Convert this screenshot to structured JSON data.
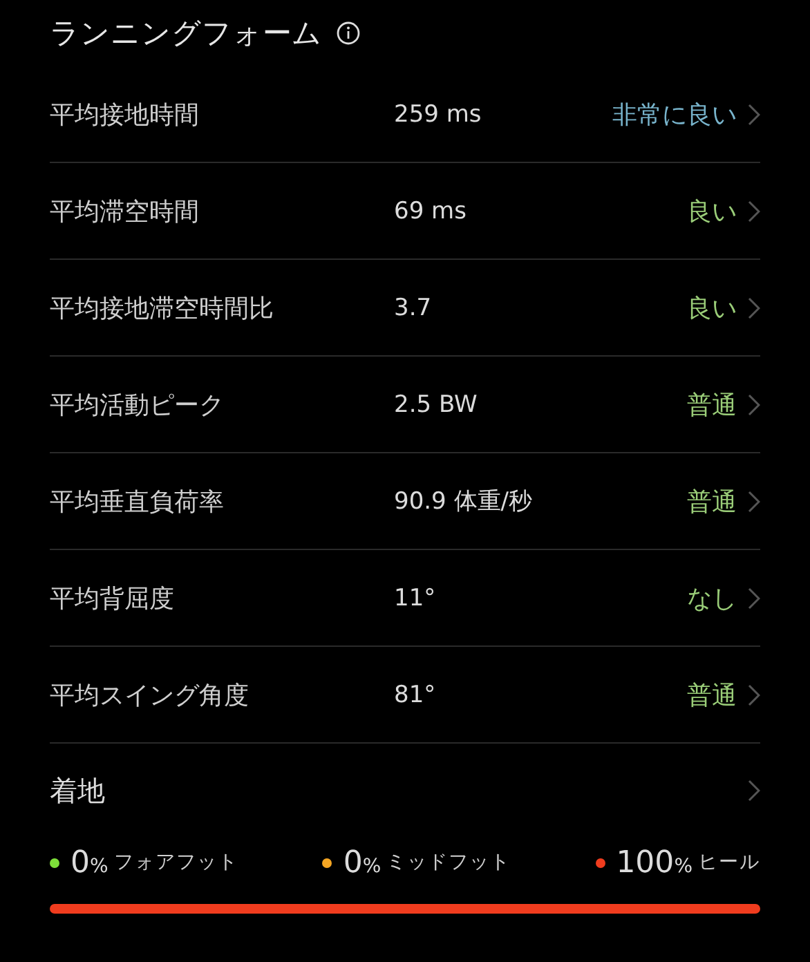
{
  "title": "ランニングフォーム",
  "metrics": [
    {
      "label": "平均接地時間",
      "value": "259 ms",
      "rating": "非常に良い",
      "color": "#78b4cc"
    },
    {
      "label": "平均滞空時間",
      "value": "69 ms",
      "rating": "良い",
      "color": "#9acd78"
    },
    {
      "label": "平均接地滞空時間比",
      "value": "3.7",
      "rating": "良い",
      "color": "#9acd78"
    },
    {
      "label": "平均活動ピーク",
      "value": "2.5 BW",
      "rating": "普通",
      "color": "#9acd78"
    },
    {
      "label": "平均垂直負荷率",
      "value": "90.9 体重/秒",
      "rating": "普通",
      "color": "#9acd78"
    },
    {
      "label": "平均背屈度",
      "value": "11°",
      "rating": "なし",
      "color": "#9acd78"
    },
    {
      "label": "平均スイング角度",
      "value": "81°",
      "rating": "普通",
      "color": "#9acd78"
    }
  ],
  "landing": {
    "label": "着地",
    "items": [
      {
        "value": "0",
        "unit": "%",
        "label": "フォアフット",
        "color": "#7ee03a",
        "level": 0
      },
      {
        "value": "0",
        "unit": "%",
        "label": "ミッドフット",
        "color": "#f5a623",
        "level": 0
      },
      {
        "value": "100",
        "unit": "%",
        "label": "ヒール",
        "color": "#f03c1e",
        "level": 1
      }
    ]
  }
}
